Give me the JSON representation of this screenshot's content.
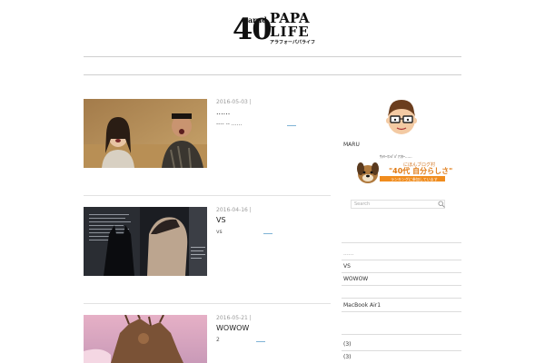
{
  "header": {
    "logo_number": "40",
    "logo_arnd": "arnd",
    "logo_papa": "PAPA",
    "logo_life": "LIFE",
    "logo_kana": "アラフォーパパライフ"
  },
  "posts": [
    {
      "date": "2016-05-03 |",
      "title": "......",
      "excerpt": "---- -- ......"
    },
    {
      "date": "2016-04-16 |",
      "title": " VS",
      "excerpt": "vs"
    },
    {
      "date": "2016-05-21 |",
      "title": " WOWOW",
      "excerpt": "2"
    }
  ],
  "sidebar": {
    "author_name": "MARU",
    "search_placeholder": "Search",
    "banner_caption_top": "ｻﾗﾘｰﾏﾝﾊﾟﾊﾟｱﾌﾀｰ......",
    "banner_caption_main": "にほんブログ村",
    "banner_caption_big": "\"40代 自分らしさ\"",
    "banner_caption_sub": "ランキングに参加しています",
    "recent_items": [
      "......",
      "VS",
      "WOWOW",
      "MacBook Air1"
    ],
    "archive_items": [
      "(3)",
      "(3)"
    ]
  },
  "colors": {
    "accent_link": "#7fb3d5",
    "banner_orange": "#f08c1e"
  }
}
